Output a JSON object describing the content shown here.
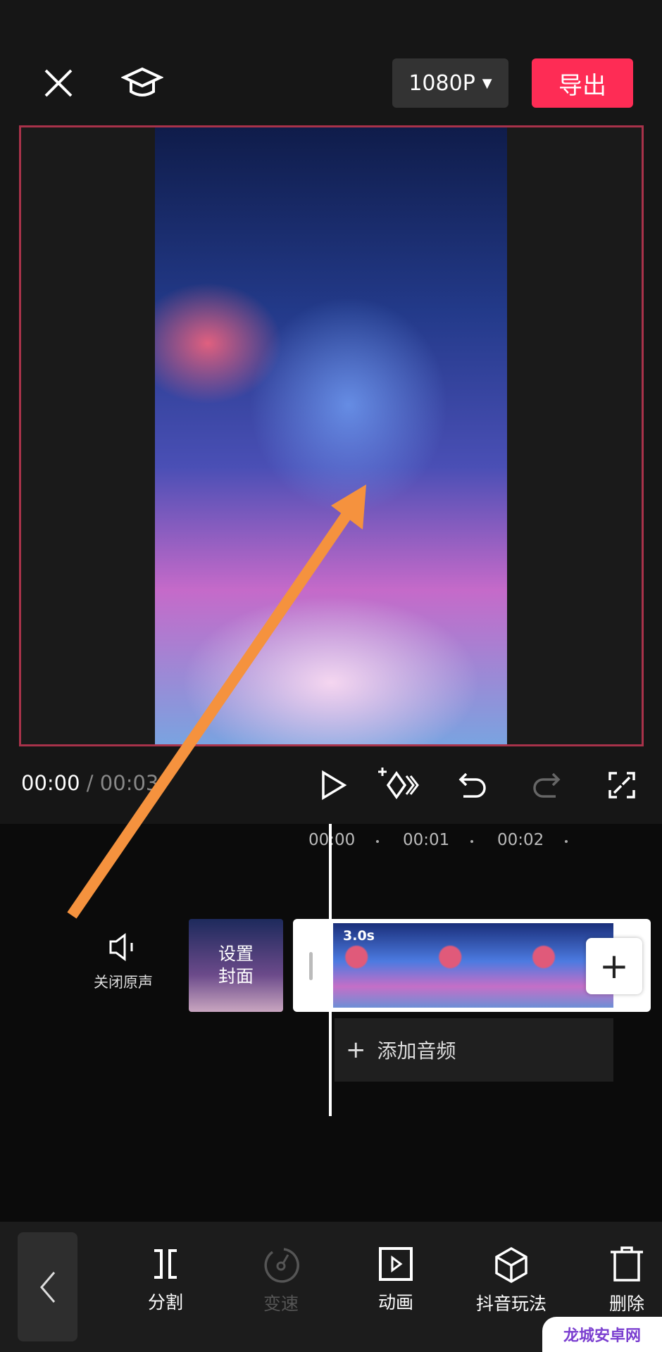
{
  "header": {
    "resolution": "1080P",
    "export_label": "导出"
  },
  "player": {
    "current_time": "00:00",
    "separator": " / ",
    "total_time": "00:03"
  },
  "timeline": {
    "ticks": [
      "00:00",
      "00:01",
      "00:02"
    ],
    "cover_label_line1": "设置",
    "cover_label_line2": "封面",
    "mute_label": "关闭原声",
    "clip_duration": "3.0s",
    "add_audio_label": "添加音频"
  },
  "toolbar": {
    "items": [
      {
        "label": "分割",
        "icon": "split-icon",
        "enabled": true
      },
      {
        "label": "变速",
        "icon": "speed-icon",
        "enabled": false
      },
      {
        "label": "动画",
        "icon": "animation-icon",
        "enabled": true
      },
      {
        "label": "抖音玩法",
        "icon": "cube-icon",
        "enabled": true
      },
      {
        "label": "删除",
        "icon": "trash-icon",
        "enabled": true
      }
    ]
  },
  "watermark": "龙城安卓网",
  "colors": {
    "accent": "#fe2c55",
    "annotation_arrow": "#f5923e"
  }
}
